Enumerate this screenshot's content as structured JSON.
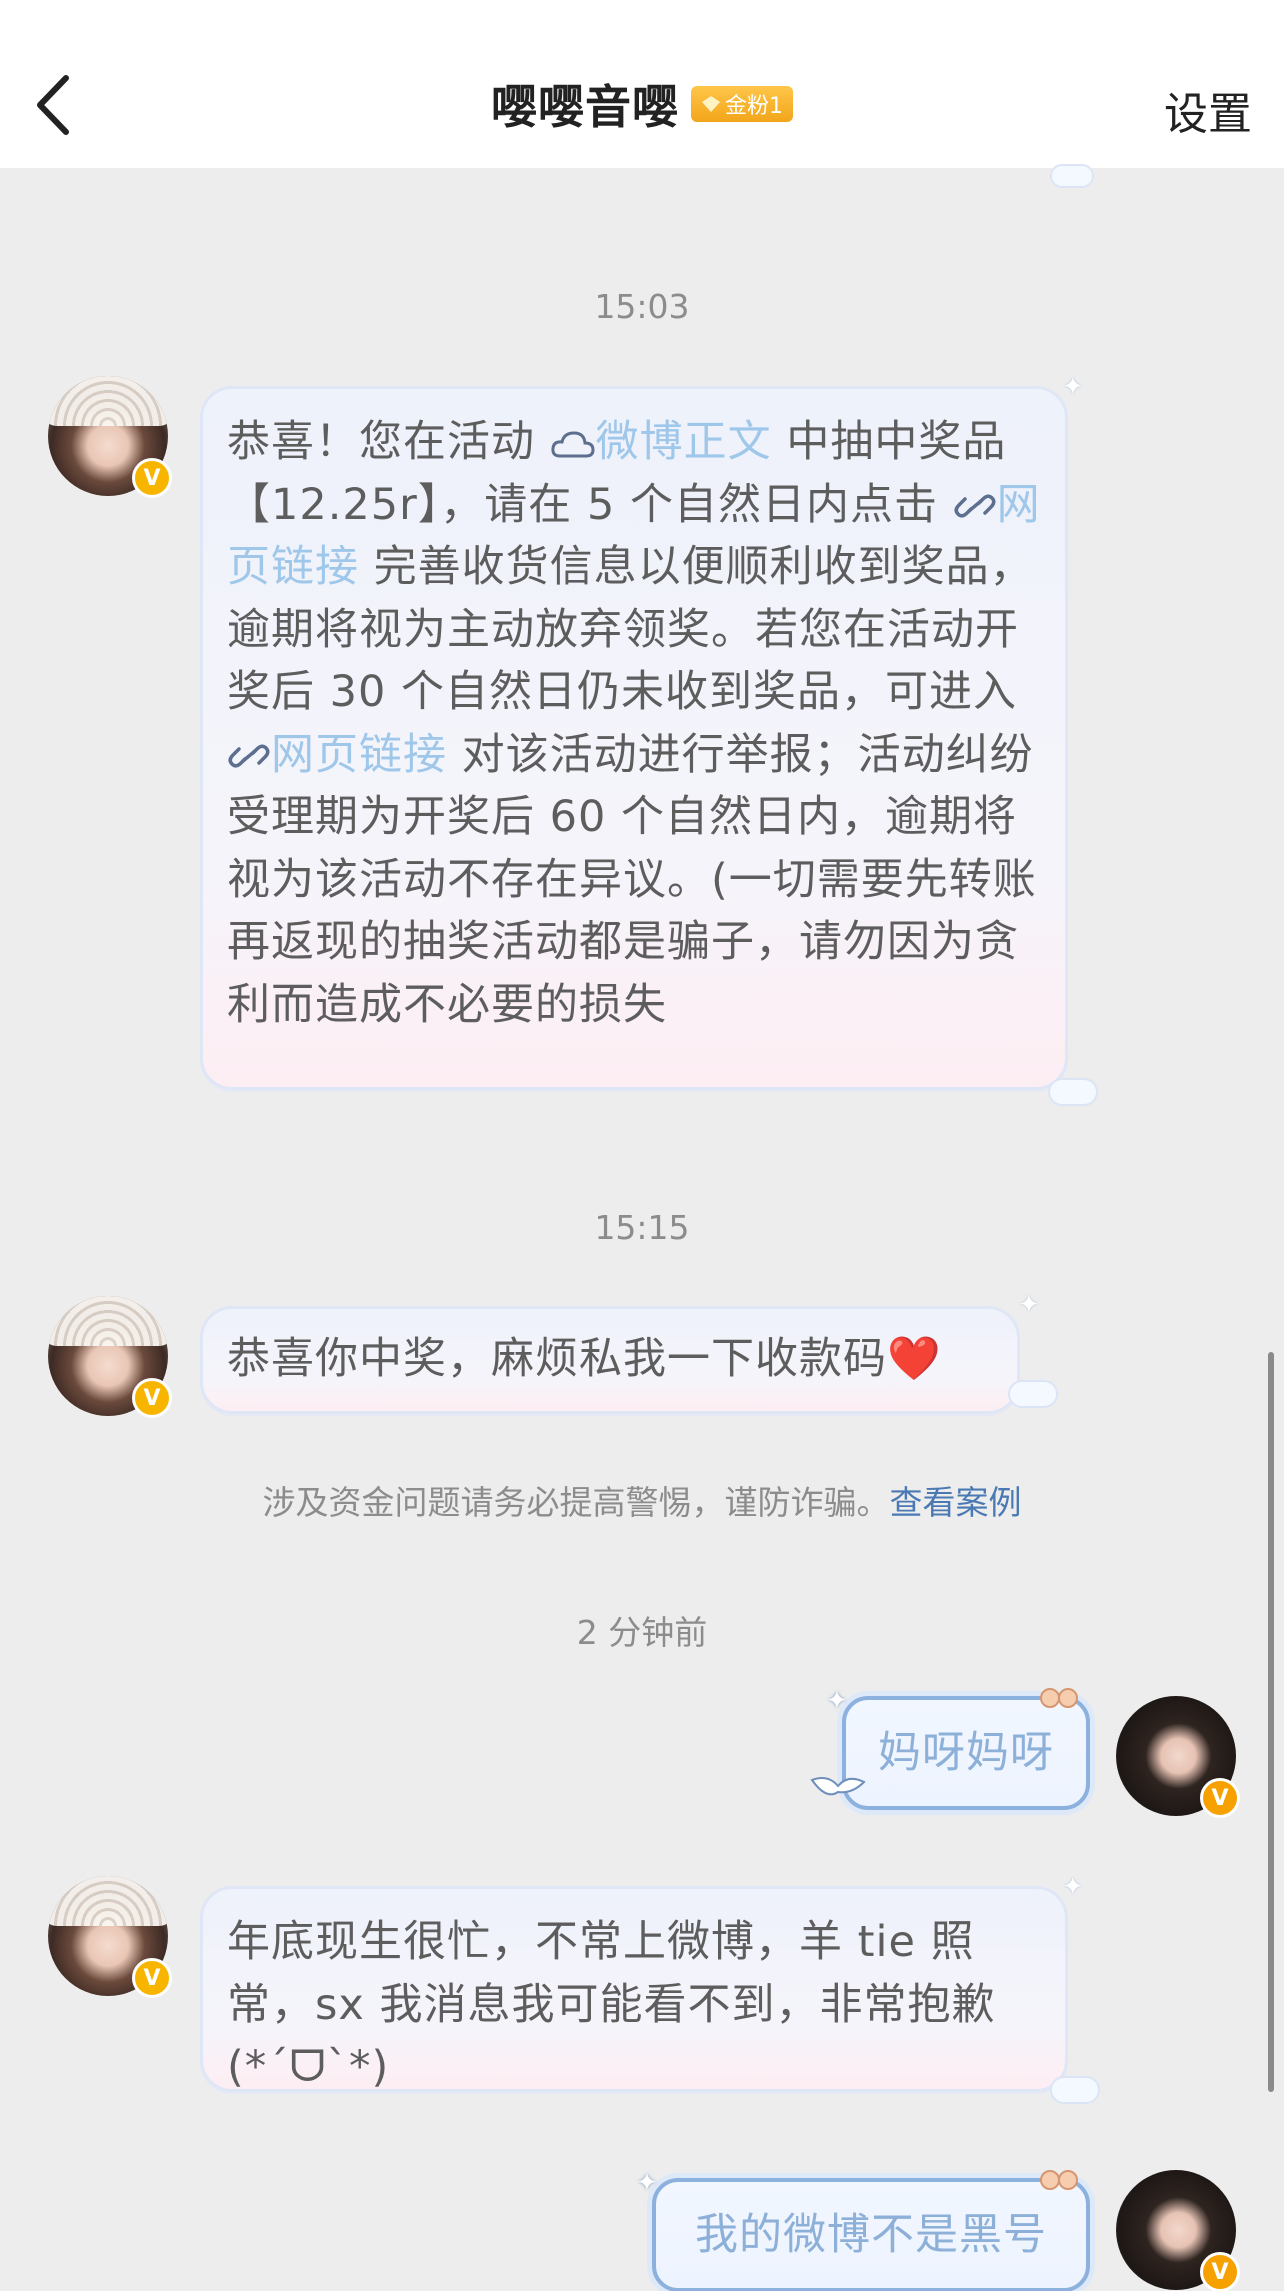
{
  "header": {
    "back_icon": "chevron-left-icon",
    "title": "嘤嘤音嘤",
    "fan_badge": "金粉1",
    "settings": "设置"
  },
  "messages": [
    {
      "time": "15:03",
      "sender": "other",
      "parts": [
        "恭喜！您在活动 ",
        "微博正文",
        " 中抽中奖品【12.25r】，请在 5 个自然日内点击 ",
        "网页链接",
        " 完善收货信息以便顺利收到奖品，逾期将视为主动放弃领奖。若您在活动开奖后 30 个自然日仍未收到奖品，可进入 ",
        "网页链接",
        " 对该活动进行举报；活动纠纷受理期为开奖后 60 个自然日内，逾期将视为该活动不存在异议。(一切需要先转账再返现的抽奖活动都是骗子，请勿因为贪利而造成不必要的损失"
      ]
    },
    {
      "time": "15:15",
      "sender": "other",
      "text": "恭喜你中奖，麻烦私我一下收款码",
      "emoji": "❤️"
    },
    {
      "notice": "涉及资金问题请务必提高警惕，谨防诈骗。",
      "notice_link": "查看案例"
    },
    {
      "time": "2 分钟前",
      "sender": "me",
      "text": "妈呀妈呀"
    },
    {
      "sender": "other",
      "text": "年底现生很忙，不常上微博，羊 tie 照常，sx 我消息我可能看不到，非常抱歉(*ˊᗜˋ*)"
    },
    {
      "sender": "me",
      "text": "我的微博不是黑号"
    }
  ],
  "colors": {
    "link": "#9fc7ea",
    "notice_link": "#4a79b4",
    "badge": "#f7b500"
  }
}
